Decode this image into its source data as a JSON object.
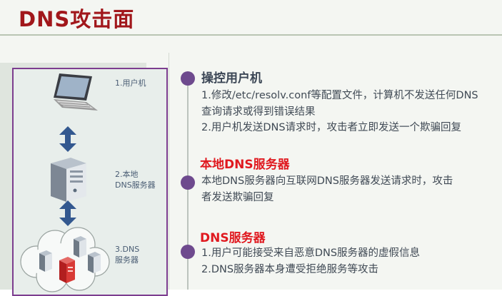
{
  "title": "DNS攻击面",
  "colors": {
    "title": "#a1171b",
    "accent_red": "#e0191f",
    "heading_dark": "#3b4655",
    "dot": "#6e4a8e"
  },
  "diagram": {
    "labels": [
      {
        "lines": [
          "1.用户机"
        ]
      },
      {
        "lines": [
          "2.本地",
          "DNS服务器"
        ]
      },
      {
        "lines": [
          "3.DNS",
          "服务器"
        ]
      }
    ],
    "icons": [
      "laptop-icon",
      "server-icon",
      "cloud-servers-icon",
      "double-arrow-icon"
    ]
  },
  "sections": [
    {
      "heading": "操控用户机",
      "lines": [
        "1.修改/etc/resolv.conf等配置文件，计算机不发送任何DNS",
        "查询请求或得到错误结果",
        "2.用户机发送DNS请求时，攻击者立即发送一个欺骗回复"
      ]
    },
    {
      "heading": "本地DNS服务器",
      "lines": [
        "本地DNS服务器向互联网DNS服务器发送请求时，攻击",
        "者发送欺骗回复"
      ]
    },
    {
      "heading": "DNS服务器",
      "lines": [
        "1.用户可能接受来自恶意DNS服务器的虚假信息",
        "2.DNS服务器本身遭受拒绝服务等攻击"
      ]
    }
  ]
}
